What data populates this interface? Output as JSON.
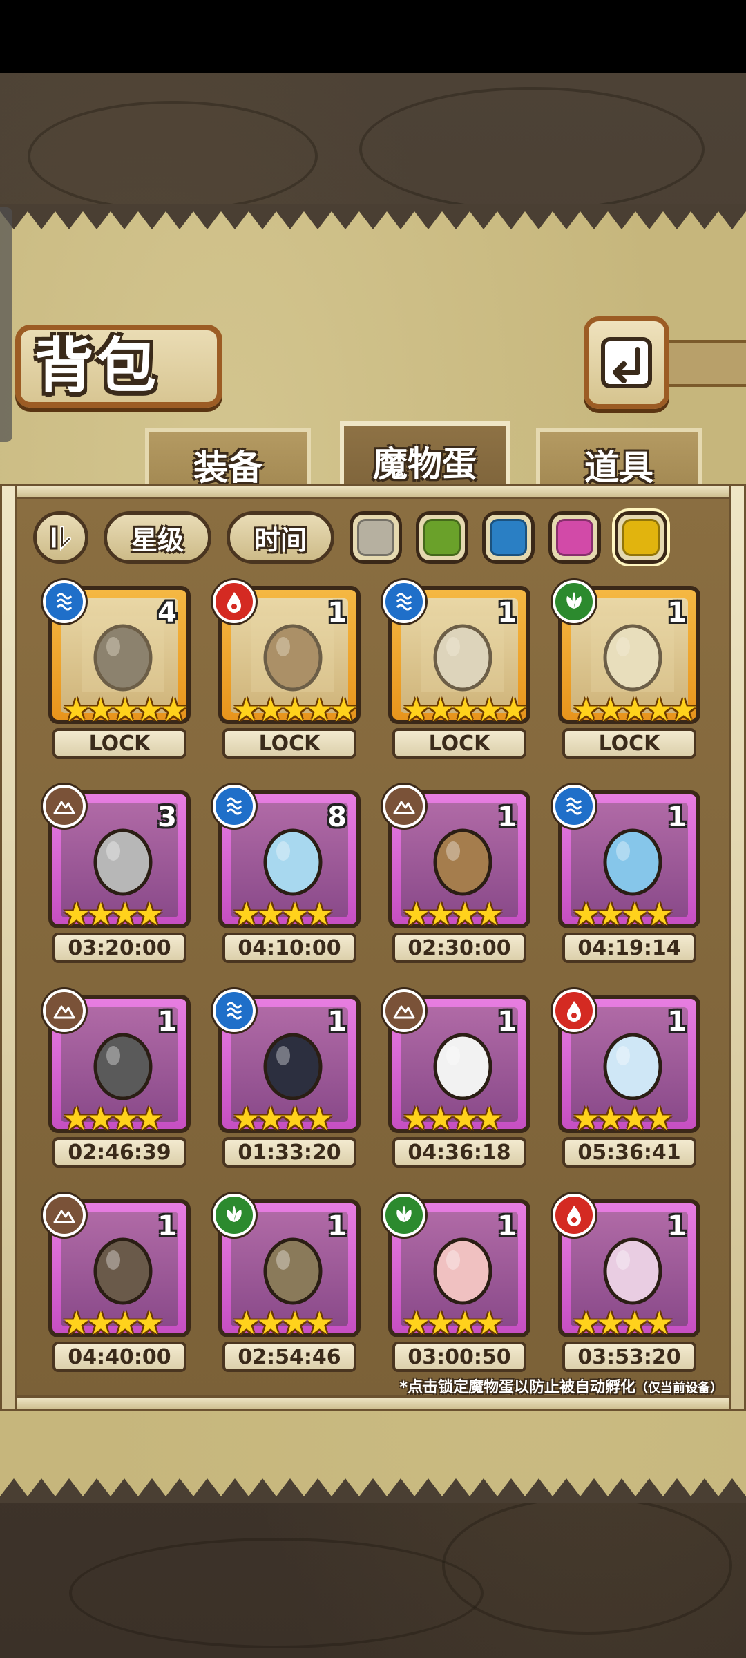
{
  "header": {
    "title": "背包"
  },
  "tabs": [
    {
      "id": "equipment",
      "label": "装备",
      "active": false
    },
    {
      "id": "monster-egg",
      "label": "魔物蛋",
      "active": true
    },
    {
      "id": "items",
      "label": "道具",
      "active": false
    }
  ],
  "filters": {
    "sort_icon": "sort-toggle-icon",
    "star_label": "星级",
    "time_label": "时间",
    "colors": [
      {
        "name": "gray",
        "hex": "#b6b0a0"
      },
      {
        "name": "green",
        "hex": "#6aa12a"
      },
      {
        "name": "blue",
        "hex": "#2a7fc4"
      },
      {
        "name": "pink",
        "hex": "#d24aa8"
      },
      {
        "name": "yellow",
        "hex": "#e1b40e",
        "selected": true
      }
    ]
  },
  "eggs": [
    {
      "rarity": "gold",
      "element": "water",
      "count": "4",
      "stars": 5,
      "label": "LOCK"
    },
    {
      "rarity": "gold",
      "element": "fire",
      "count": "1",
      "stars": 5,
      "label": "LOCK"
    },
    {
      "rarity": "gold",
      "element": "water",
      "count": "1",
      "stars": 5,
      "label": "LOCK"
    },
    {
      "rarity": "gold",
      "element": "nature",
      "count": "1",
      "stars": 5,
      "label": "LOCK"
    },
    {
      "rarity": "pink",
      "element": "earth",
      "count": "3",
      "stars": 4,
      "label": "03:20:00"
    },
    {
      "rarity": "pink",
      "element": "water",
      "count": "8",
      "stars": 4,
      "label": "04:10:00"
    },
    {
      "rarity": "pink",
      "element": "earth",
      "count": "1",
      "stars": 4,
      "label": "02:30:00"
    },
    {
      "rarity": "pink",
      "element": "water",
      "count": "1",
      "stars": 4,
      "label": "04:19:14"
    },
    {
      "rarity": "pink",
      "element": "earth",
      "count": "1",
      "stars": 4,
      "label": "02:46:39"
    },
    {
      "rarity": "pink",
      "element": "water",
      "count": "1",
      "stars": 4,
      "label": "01:33:20"
    },
    {
      "rarity": "pink",
      "element": "earth",
      "count": "1",
      "stars": 4,
      "label": "04:36:18"
    },
    {
      "rarity": "pink",
      "element": "fire",
      "count": "1",
      "stars": 4,
      "label": "05:36:41"
    },
    {
      "rarity": "pink",
      "element": "earth",
      "count": "1",
      "stars": 4,
      "label": "04:40:00"
    },
    {
      "rarity": "pink",
      "element": "nature",
      "count": "1",
      "stars": 4,
      "label": "02:54:46"
    },
    {
      "rarity": "pink",
      "element": "nature",
      "count": "1",
      "stars": 4,
      "label": "03:00:50"
    },
    {
      "rarity": "pink",
      "element": "fire",
      "count": "1",
      "stars": 4,
      "label": "03:53:20"
    }
  ],
  "footer": {
    "note": "*点击锁定魔物蛋以防止被自动孵化",
    "note_small": "（仅当前设备）"
  },
  "element_colors": {
    "water": "#1f6fc9",
    "fire": "#d42a22",
    "nature": "#2c8a2e",
    "earth": "#7a5238"
  }
}
